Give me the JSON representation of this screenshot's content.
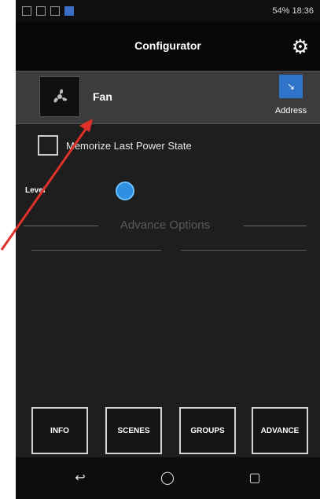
{
  "status_bar": {
    "left_icons": [
      "whatsapp-icon",
      "image-icon",
      "warning-icon",
      "app-icon"
    ],
    "right_text": "54% 18:36"
  },
  "header": {
    "title": "Configurator",
    "settings_icon": "gear-icon"
  },
  "device": {
    "name": "Fan",
    "icon": "fan-icon",
    "address_label": "Address"
  },
  "options": {
    "memorize_label": "Memorize Last Power State",
    "memorize_checked": false,
    "level_label": "Level",
    "advance_section_label": "Advance Options"
  },
  "tabs": [
    {
      "label": "INFO"
    },
    {
      "label": "SCENES"
    },
    {
      "label": "GROUPS"
    },
    {
      "label": "ADVANCE"
    }
  ],
  "nav": {
    "back_icon": "back-icon",
    "home_icon": "home-icon",
    "recents_icon": "recents-icon"
  },
  "colors": {
    "accent": "#2f74c8",
    "annotation_arrow": "#e0302a"
  }
}
